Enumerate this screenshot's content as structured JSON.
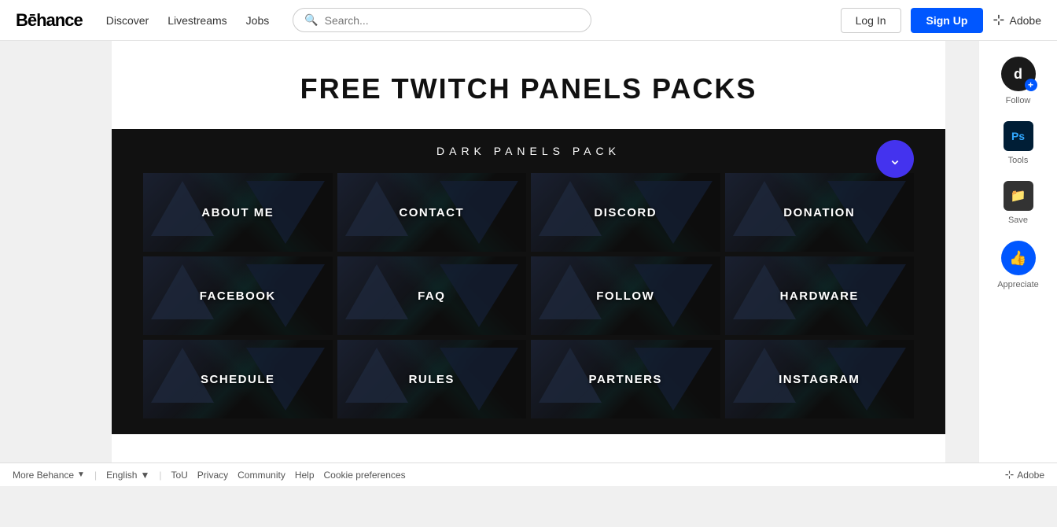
{
  "navbar": {
    "logo": "Bēhance",
    "links": [
      "Discover",
      "Livestreams",
      "Jobs"
    ],
    "search_placeholder": "Search...",
    "login_label": "Log In",
    "signup_label": "Sign Up",
    "adobe_label": "Adobe"
  },
  "project": {
    "title": "FREE TWITCH PANELS PACKS",
    "dark_pack_header": "DARK PANELS PACK",
    "panels": [
      "ABOUT ME",
      "CONTACT",
      "DISCORD",
      "DONATION",
      "FACEBOOK",
      "FAQ",
      "FOLLOW",
      "HARDWARE",
      "SCHEDULE",
      "RULES",
      "PARTNERS",
      "INSTAGRAM"
    ]
  },
  "sidebar": {
    "avatar_letter": "d",
    "follow_label": "Follow",
    "tools_label": "Tools",
    "save_label": "Save",
    "appreciate_label": "Appreciate",
    "ps_tool": "Ps"
  },
  "footer": {
    "more_behance": "More Behance",
    "language": "English",
    "tou": "ToU",
    "privacy": "Privacy",
    "community": "Community",
    "help": "Help",
    "cookie": "Cookie preferences",
    "adobe": "Adobe"
  }
}
